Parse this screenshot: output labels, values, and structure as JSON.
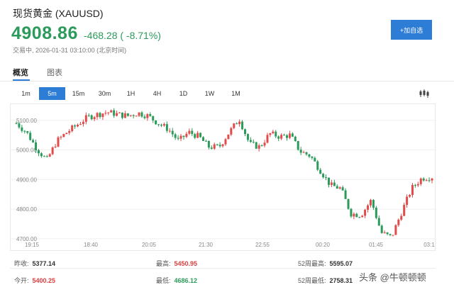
{
  "header": {
    "title": "现货黄金 (XAUUSD)",
    "price": "4908.86",
    "change": "-468.28 ( -8.71%)",
    "status": "交易中, 2026-01-31 03:10:00 (北京时间)",
    "add_button": "+加自选"
  },
  "tabs": [
    {
      "label": "概览",
      "active": true
    },
    {
      "label": "图表",
      "active": false
    }
  ],
  "timeframes": [
    {
      "label": "1m",
      "active": false
    },
    {
      "label": "5m",
      "active": true
    },
    {
      "label": "15m",
      "active": false
    },
    {
      "label": "30m",
      "active": false
    },
    {
      "label": "1H",
      "active": false
    },
    {
      "label": "4H",
      "active": false
    },
    {
      "label": "1D",
      "active": false
    },
    {
      "label": "1W",
      "active": false
    },
    {
      "label": "1M",
      "active": false
    }
  ],
  "chart_type_icon": "candlestick-icon",
  "colors": {
    "up": "#e34b4b",
    "down": "#2c9a5b",
    "accent": "#2d7cd6"
  },
  "chart_data": {
    "type": "candlestick",
    "x_tick_labels": [
      "19:15",
      "18:40",
      "20:05",
      "21:30",
      "22:55",
      "00:20",
      "01:45",
      "03:1"
    ],
    "y_tick_labels": [
      "5100.00",
      "5000.00",
      "4900.00",
      "4800.00",
      "4700.00"
    ],
    "ylim": [
      4690,
      5145
    ],
    "grid": true,
    "close_path": [
      5090,
      5060,
      5005,
      4965,
      5030,
      5060,
      5085,
      5110,
      5120,
      5128,
      5120,
      5115,
      5125,
      5115,
      5090,
      5070,
      5030,
      5060,
      5045,
      5010,
      5010,
      5060,
      5105,
      5020,
      5010,
      5055,
      5045,
      5050,
      4995,
      4980,
      4930,
      4880,
      4870,
      4785,
      4780,
      4830,
      4720,
      4705,
      4790,
      4870,
      4905,
      4908.86
    ]
  },
  "stats": {
    "prev_close": {
      "label": "昨收:",
      "value": "5377.14"
    },
    "open": {
      "label": "今开:",
      "value": "5400.25"
    },
    "high": {
      "label": "最高:",
      "value": "5450.95"
    },
    "low": {
      "label": "最低:",
      "value": "4686.12"
    },
    "w52_high": {
      "label": "52周最高:",
      "value": "5595.07"
    },
    "w52_low": {
      "label": "52周最低:",
      "value": "2758.31"
    }
  },
  "watermark": {
    "text": "头条 @牛顿顿顿"
  }
}
